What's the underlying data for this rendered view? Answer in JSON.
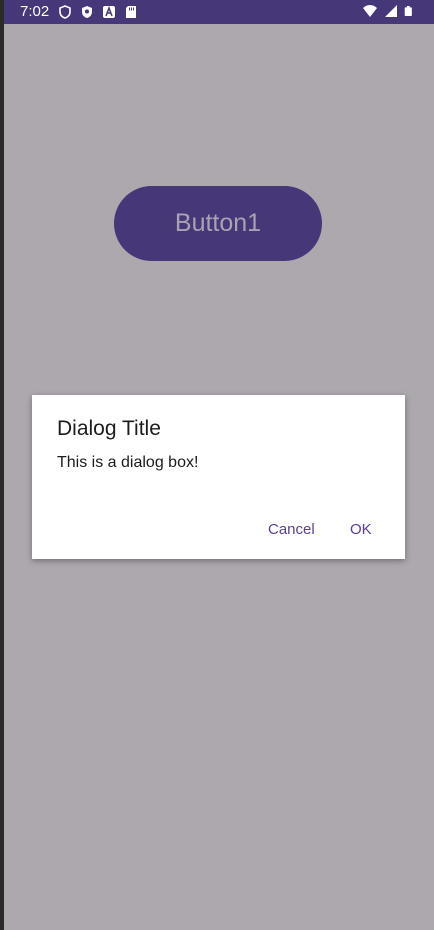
{
  "status_bar": {
    "time": "7:02",
    "left_icons": [
      "vpn-shield-icon",
      "play-protect-icon",
      "a-badge-icon",
      "sd-card-icon"
    ],
    "right_icons": [
      "wifi-icon",
      "cellular-signal-icon",
      "battery-icon"
    ]
  },
  "main": {
    "button_label": "Button1"
  },
  "dialog": {
    "title": "Dialog Title",
    "message": "This is a dialog box!",
    "cancel_label": "Cancel",
    "ok_label": "OK"
  },
  "colors": {
    "status_bar": "#453778",
    "scrim_background": "#ada8ae",
    "button": "#453778",
    "dialog_button_text": "#5b3f93"
  }
}
